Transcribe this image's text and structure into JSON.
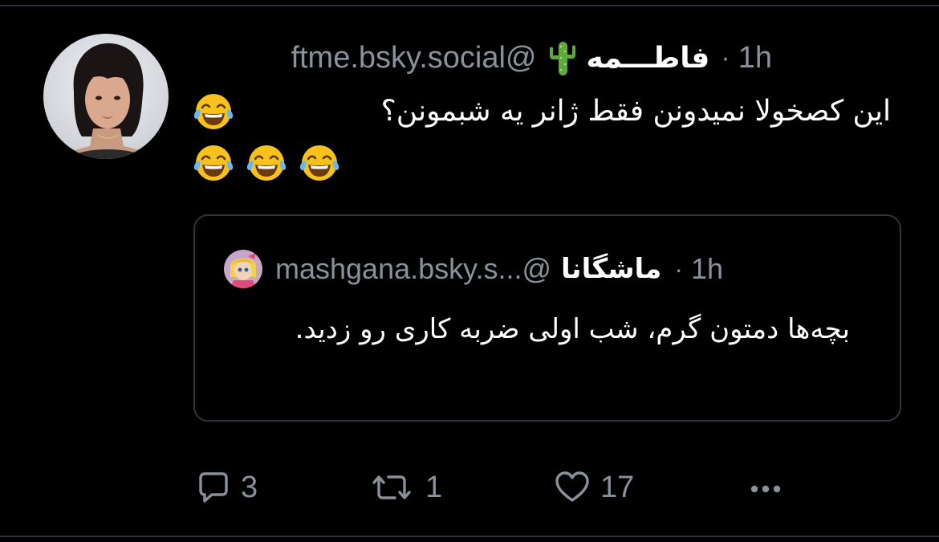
{
  "post": {
    "display_name": "فاطـــمه",
    "name_emoji": "cactus-icon",
    "handle": "ftme.bsky.social@",
    "separator": "·",
    "time": "1h",
    "text": "این کصخولا نمیدونن فقط ژانر یه شبمونن؟",
    "trailing_emoji": "face-with-tears-of-joy-icon",
    "emoji_row_count": 3
  },
  "quote": {
    "display_name": "ماشگانا",
    "handle": "mashgana.bsky.s...@",
    "separator": "·",
    "time": "1h",
    "text": "بچه‌ها دمتون گرم، شب اولی ضربه کاری رو زدید."
  },
  "actions": {
    "reply_count": "3",
    "repost_count": "1",
    "like_count": "17"
  },
  "colors": {
    "background": "#000000",
    "muted_text": "#8a919b",
    "border": "#2f343b",
    "text": "#ffffff"
  }
}
